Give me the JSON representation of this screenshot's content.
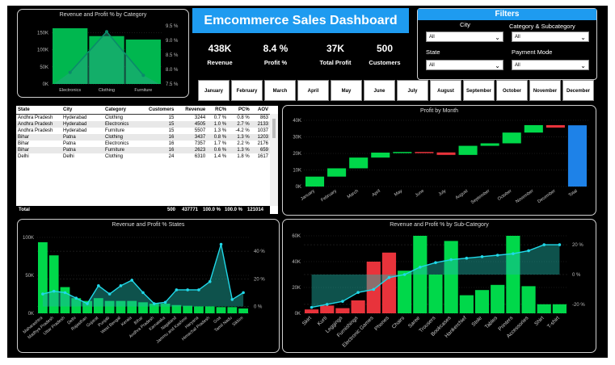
{
  "header": {
    "title": "Emcommerce Sales Dashboard"
  },
  "kpis": [
    {
      "value": "438K",
      "label": "Revenue"
    },
    {
      "value": "8.4 %",
      "label": "Profit %"
    },
    {
      "value": "37K",
      "label": "Total Profit"
    },
    {
      "value": "500",
      "label": "Customers"
    }
  ],
  "filters": {
    "title": "Filters",
    "city": {
      "label": "City",
      "value": "All"
    },
    "category": {
      "label": "Category & Subcategory",
      "value": "All"
    },
    "state": {
      "label": "State",
      "value": "All"
    },
    "payment": {
      "label": "Payment Mode",
      "value": "All"
    }
  },
  "months": [
    "January",
    "February",
    "March",
    "April",
    "May",
    "June",
    "July",
    "August",
    "September",
    "October",
    "November",
    "December"
  ],
  "table": {
    "headers": [
      "State",
      "City",
      "Category",
      "Customers",
      "Revenue",
      "RC%",
      "PC%",
      "AOV"
    ],
    "rows": [
      [
        "Andhra Pradesh",
        "Hyderabad",
        "Clothing",
        "15",
        "3244",
        "0.7 %",
        "0.8 %",
        "863"
      ],
      [
        "Andhra Pradesh",
        "Hyderabad",
        "Electronics",
        "15",
        "4505",
        "1.0 %",
        "2.7 %",
        "2133"
      ],
      [
        "Andhra Pradesh",
        "Hyderabad",
        "Furniture",
        "15",
        "5507",
        "1.3 %",
        "-4.2 %",
        "1037"
      ],
      [
        "Bihar",
        "Patna",
        "Clothing",
        "16",
        "3437",
        "0.8 %",
        "1.3 %",
        "1203"
      ],
      [
        "Bihar",
        "Patna",
        "Electronics",
        "16",
        "7357",
        "1.7 %",
        "2.2 %",
        "2176"
      ],
      [
        "Bihar",
        "Patna",
        "Furniture",
        "16",
        "2623",
        "0.6 %",
        "1.3 %",
        "659"
      ],
      [
        "Delhi",
        "Delhi",
        "Clothing",
        "24",
        "6310",
        "1.4 %",
        "1.8 %",
        "1617"
      ]
    ],
    "total": [
      "Total",
      "",
      "",
      "500",
      "437771",
      "100.0 %",
      "100.0 %",
      "121014"
    ]
  },
  "chart_data": [
    {
      "type": "bar",
      "title": "Revenue and Profit % by Category",
      "categories": [
        "Electronics",
        "Clothing",
        "Furniture"
      ],
      "series": [
        {
          "name": "Revenue",
          "values": [
            163000,
            140000,
            130000
          ]
        },
        {
          "name": "Profit %",
          "values": [
            7.9,
            9.3,
            7.8
          ]
        }
      ],
      "ylim": [
        0,
        170000
      ],
      "yticks": [
        "0K",
        "50K",
        "100K",
        "150K"
      ],
      "y2ticks": [
        "7.5 %",
        "8.0 %",
        "8.5 %",
        "9.0 %",
        "9.5 %"
      ],
      "colors": {
        "bar": "#00b74f",
        "line": "#0b8a6a"
      }
    },
    {
      "type": "bar",
      "title": "Profit by Month",
      "categories": [
        "January",
        "February",
        "March",
        "April",
        "May",
        "June",
        "July",
        "August",
        "September",
        "October",
        "November",
        "December",
        "Total"
      ],
      "values": [
        6000,
        5000,
        6500,
        3000,
        400,
        -300,
        -1500,
        5500,
        1500,
        6500,
        4500,
        -1500,
        37000
      ],
      "ylim": [
        0,
        40000
      ],
      "yticks": [
        "0K",
        "10K",
        "20K",
        "30K",
        "40K"
      ],
      "colors": {
        "increase": "#00d84a",
        "decrease": "#e8333b",
        "total": "#1e82e8"
      }
    },
    {
      "type": "bar",
      "title": "Revenue and Profit % States",
      "categories": [
        "Maharashtra",
        "Madhya Pradesh",
        "Uttar Pradesh",
        "Delhi",
        "Rajasthan",
        "Gujarat",
        "Punjab",
        "West Bengal",
        "Kerala",
        "Bihar",
        "Andhra Pradesh",
        "Karnataka",
        "Nagaland",
        "Jammu and Kashmir",
        "Haryana",
        "Himachal Pradesh",
        "Goa",
        "Tamil Nadu",
        "Sikkim"
      ],
      "series": [
        {
          "name": "Revenue",
          "values": [
            103000,
            84000,
            38000,
            22000,
            18000,
            22000,
            18000,
            18000,
            18000,
            16000,
            14000,
            14000,
            12000,
            11000,
            10000,
            10000,
            9000,
            9000,
            7000
          ]
        },
        {
          "name": "Profit %",
          "values": [
            9,
            11,
            10,
            6,
            2,
            15,
            9,
            15,
            19,
            10,
            2,
            3,
            12,
            12,
            12,
            18,
            45,
            5,
            10
          ]
        }
      ],
      "ylim": [
        0,
        110000
      ],
      "yticks": [
        "0K",
        "50K",
        "100K"
      ],
      "y2ticks": [
        "0 %",
        "20 %",
        "40 %"
      ],
      "colors": {
        "positive": "#00d84a",
        "negative": "#e8333b",
        "line": "#20d8e8"
      }
    },
    {
      "type": "bar",
      "title": "Revenue and Profit % by Sub-Category",
      "categories": [
        "Skirt",
        "Kurti",
        "Leggings",
        "Furnishings",
        "Electronic Games",
        "Phones",
        "Chairs",
        "Saree",
        "Trousers",
        "Bookcases",
        "Hankerchief",
        "Stole",
        "Tables",
        "Printers",
        "Accessories",
        "Shirt",
        "T-shirt"
      ],
      "series": [
        {
          "name": "Revenue",
          "values": [
            3000,
            6000,
            4000,
            10000,
            40000,
            47000,
            33000,
            60000,
            30000,
            56000,
            14000,
            18000,
            22000,
            60000,
            21000,
            7000,
            7000
          ]
        },
        {
          "name": "Profit %",
          "values": [
            -22,
            -20,
            -18,
            -12,
            -10,
            -2,
            0,
            5,
            8,
            10,
            11,
            12,
            13,
            14,
            16,
            20,
            20
          ]
        }
      ],
      "ylim": [
        0,
        60000
      ],
      "yticks": [
        "0K",
        "20K",
        "40K",
        "60K"
      ],
      "y2ticks": [
        "-20 %",
        "0 %",
        "20 %"
      ],
      "colors": {
        "positive": "#00d84a",
        "negative": "#e8333b",
        "line": "#20d8e8"
      }
    }
  ]
}
